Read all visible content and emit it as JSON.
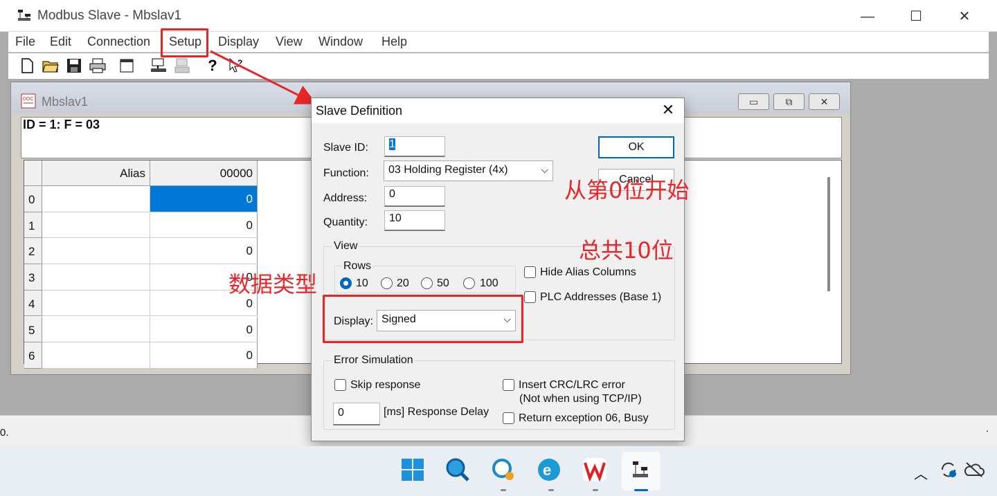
{
  "app": {
    "title": "Modbus Slave - Mbslav1",
    "window_controls": {
      "minimize": "—",
      "maximize": "☐",
      "close": "✕"
    },
    "menu": [
      "File",
      "Edit",
      "Connection",
      "Setup",
      "Display",
      "View",
      "Window",
      "Help"
    ]
  },
  "toolbar": {
    "icons": [
      "new-file-icon",
      "open-folder-icon",
      "save-icon",
      "print-icon",
      "window-icon",
      "connect-icon",
      "disconnect-icon",
      "help-icon",
      "context-help-icon"
    ]
  },
  "child_window": {
    "title": "Mbslav1",
    "id_line": "ID = 1: F = 03",
    "columns": [
      "Alias",
      "00000"
    ],
    "rows": [
      {
        "index": "0",
        "alias": "",
        "value": "0"
      },
      {
        "index": "1",
        "alias": "",
        "value": "0"
      },
      {
        "index": "2",
        "alias": "",
        "value": "0"
      },
      {
        "index": "3",
        "alias": "",
        "value": "0"
      },
      {
        "index": "4",
        "alias": "",
        "value": "0"
      },
      {
        "index": "5",
        "alias": "",
        "value": "0"
      },
      {
        "index": "6",
        "alias": "",
        "value": "0"
      }
    ]
  },
  "dialog": {
    "title": "Slave Definition",
    "slave_id_label": "Slave ID:",
    "slave_id": "1",
    "function_label": "Function:",
    "function": "03 Holding Register (4x)",
    "address_label": "Address:",
    "address": "0",
    "quantity_label": "Quantity:",
    "quantity": "10",
    "ok": "OK",
    "cancel": "Cancel",
    "view_label": "View",
    "rows_label": "Rows",
    "row_options": [
      "10",
      "20",
      "50",
      "100"
    ],
    "selected_rows": "10",
    "hide_alias": "Hide Alias Columns",
    "plc_addresses": "PLC Addresses (Base 1)",
    "display_label": "Display:",
    "display": "Signed",
    "error_sim_label": "Error Simulation",
    "skip_response": "Skip response",
    "response_delay": "0",
    "response_delay_label": "[ms] Response Delay",
    "insert_crc": "Insert CRC/LRC error",
    "insert_crc_note": "(Not when using TCP/IP)",
    "return_exception": "Return exception 06, Busy"
  },
  "annotations": {
    "address_note": "从第0位开始",
    "quantity_note": "总共10位",
    "display_note": "数据类型"
  },
  "status": {
    "left": "0.",
    "right": "."
  },
  "colors": {
    "highlight": "#e8262a",
    "selection": "#0078d7",
    "accent": "#0067c0"
  }
}
